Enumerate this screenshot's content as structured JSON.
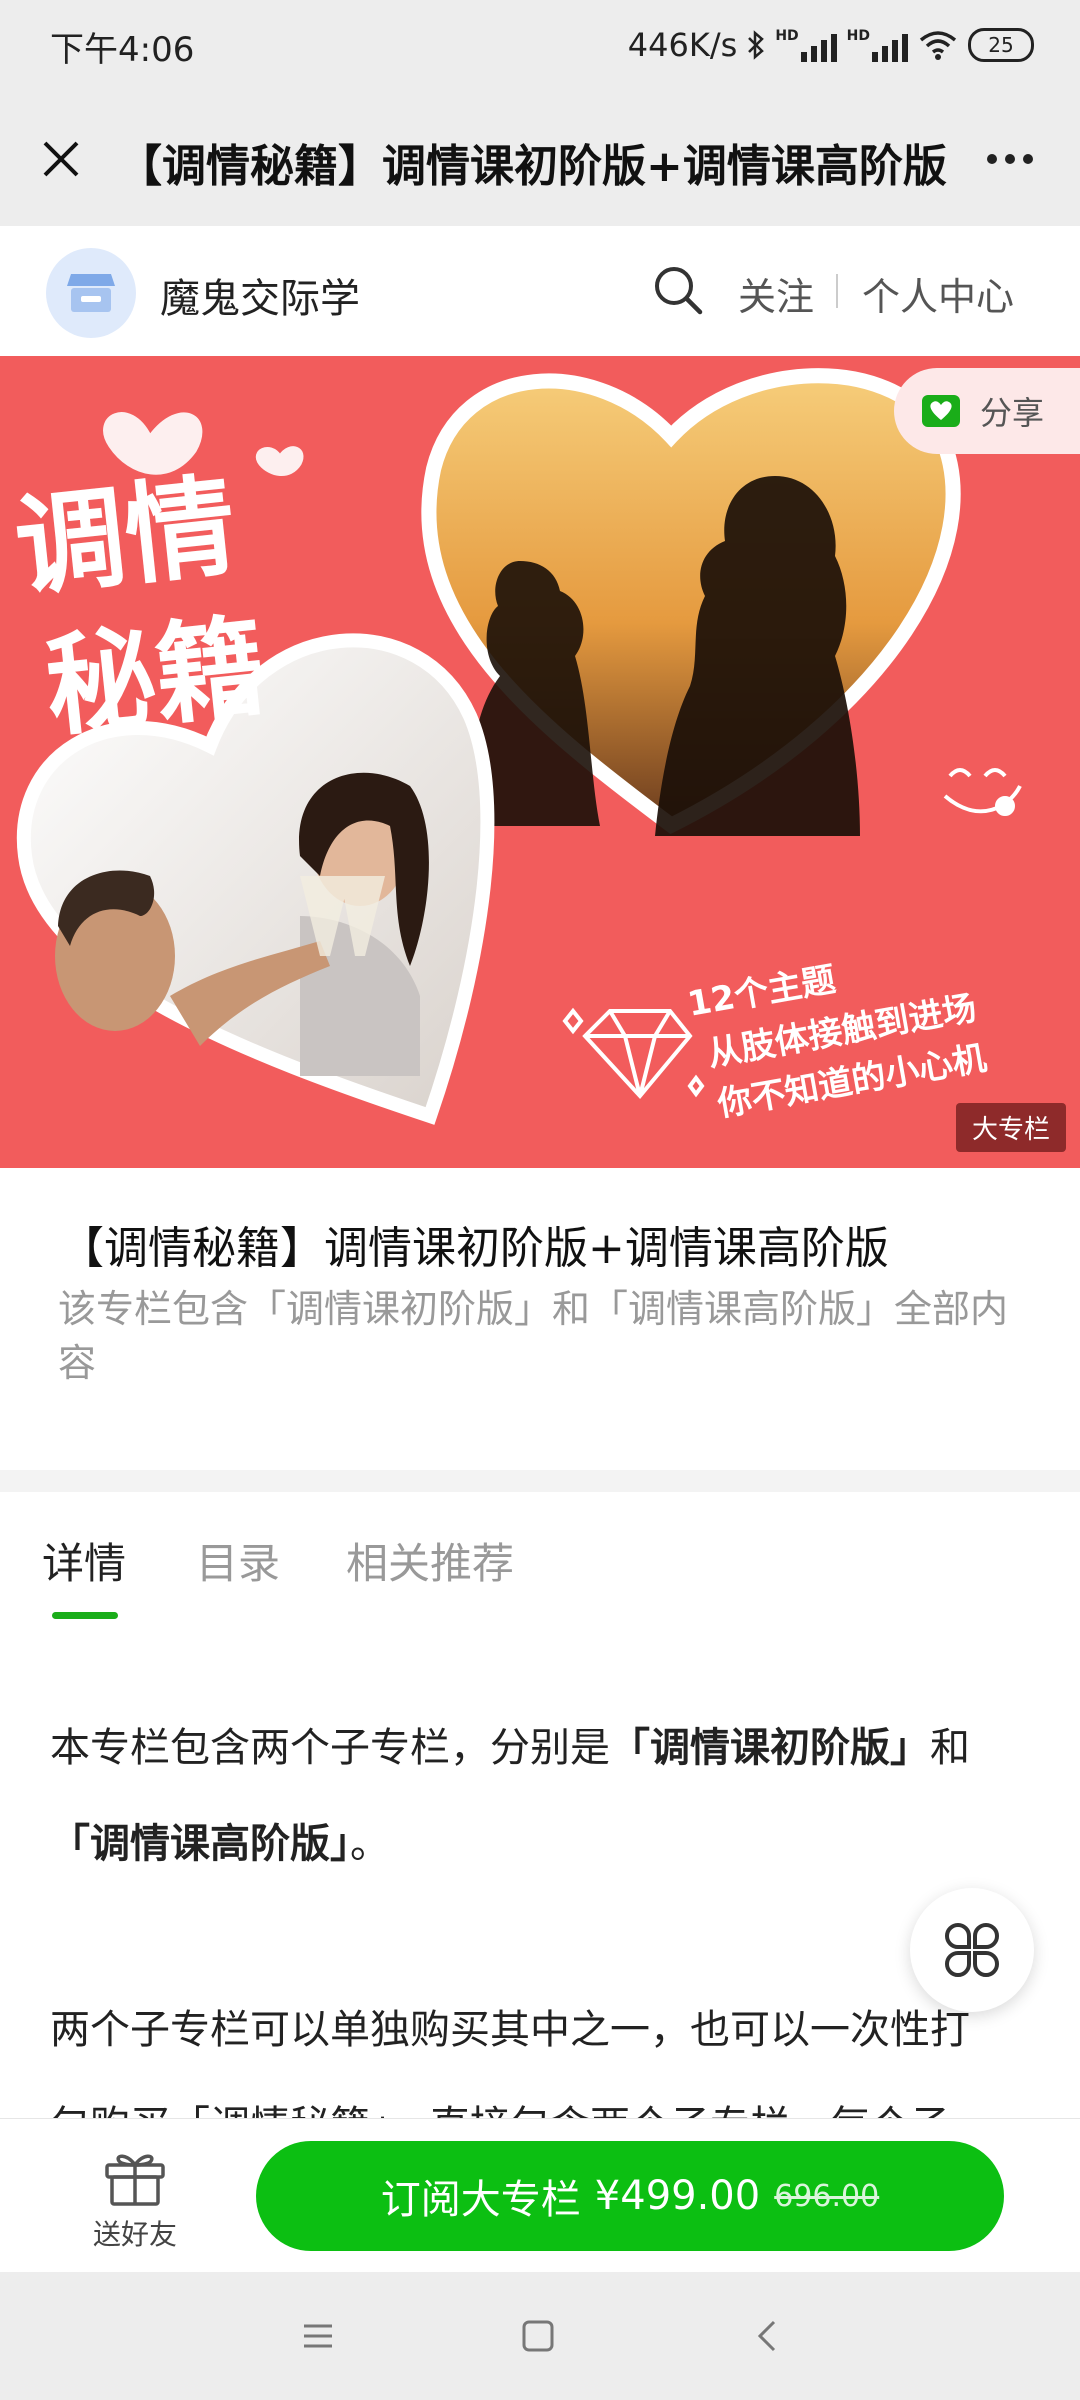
{
  "status_bar": {
    "time": "下午4:06",
    "network_speed": "446K/s",
    "signal_1": "HD",
    "signal_2": "HD",
    "battery": "25"
  },
  "title_bar": {
    "title": "【调情秘籍】调情课初阶版+调情课高阶版"
  },
  "shop": {
    "name": "魔鬼交际学",
    "follow": "关注",
    "profile": "个人中心"
  },
  "banner": {
    "share_label": "分享",
    "badge": "大专栏",
    "art_title_line1": "调情",
    "art_title_line2": "秘籍",
    "art_caption_line1": "12个主题",
    "art_caption_line2": "从肢体接触到进场",
    "art_caption_line3": "你不知道的小心机"
  },
  "column": {
    "title": "【调情秘籍】调情课初阶版+调情课高阶版",
    "desc": "该专栏包含「调情课初阶版」和「调情课高阶版」全部内容"
  },
  "tabs": [
    {
      "label": "详情"
    },
    {
      "label": "目录"
    },
    {
      "label": "相关推荐"
    }
  ],
  "content": {
    "p1_part1": "本专栏包含两个子专栏，分别是",
    "p1_bold1": "「调情课初阶版」",
    "p1_part2": "和",
    "p1_bold2": "「调情课高阶版」",
    "p1_part3": "。",
    "p2": "两个子专栏可以单独购买其中之一，也可以一次性打",
    "p3": "包购买「调情秘籍」，直接包含两个子专栏，每个子"
  },
  "bottom": {
    "gift_label": "送好友",
    "subscribe_label": "订阅大专栏",
    "price": "¥499.00",
    "original_price": "696.00"
  },
  "colors": {
    "accent": "#0cbf12",
    "tab_indicator": "#1aad19",
    "banner_bg": "#f25c5c"
  }
}
